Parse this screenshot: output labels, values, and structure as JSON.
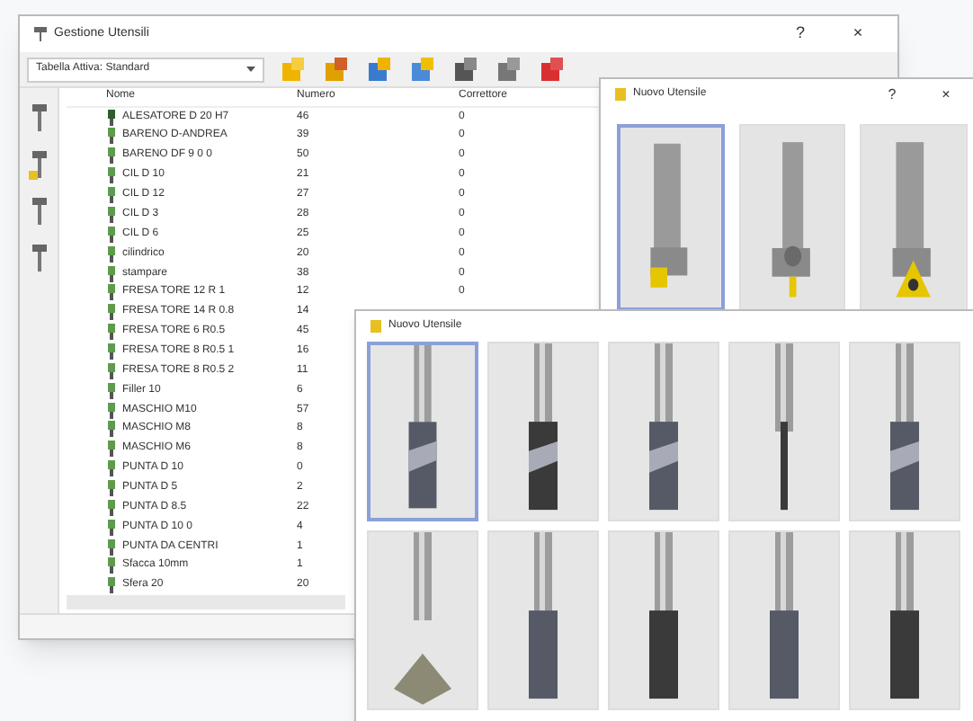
{
  "main_window": {
    "title": "Gestione Utensili",
    "controls": [
      "?",
      "×"
    ],
    "table_selector": {
      "value": "Tabella Attiva: Standard"
    },
    "table": {
      "columns": [
        "Nome",
        "Numero",
        "Correttore"
      ],
      "rows": [
        {
          "name": "ALESATORE D 20 H7",
          "number": "46",
          "corrector": "0"
        },
        {
          "name": "BARENO D-ANDREA",
          "number": "39",
          "corrector": "0"
        },
        {
          "name": "BARENO DF 9 0 0",
          "number": "50",
          "corrector": "0"
        },
        {
          "name": "CIL D 10",
          "number": "21",
          "corrector": "0"
        },
        {
          "name": "CIL D 12",
          "number": "27",
          "corrector": "0"
        },
        {
          "name": "CIL D 3",
          "number": "28",
          "corrector": "0"
        },
        {
          "name": "CIL D 6",
          "number": "25",
          "corrector": "0"
        },
        {
          "name": "cilindrico",
          "number": "20",
          "corrector": "0"
        },
        {
          "name": "stampare",
          "number": "38",
          "corrector": "0"
        },
        {
          "name": "FRESA TORE 12 R 1",
          "number": "12",
          "corrector": "0"
        },
        {
          "name": "FRESA TORE 14 R 0.8",
          "number": "14"
        },
        {
          "name": "FRESA TORE 6 R0.5",
          "number": "45"
        },
        {
          "name": "FRESA TORE 8 R0.5 1",
          "number": "16"
        },
        {
          "name": "FRESA TORE 8 R0.5 2",
          "number": "11"
        },
        {
          "name": "Filler 10",
          "number": "6"
        },
        {
          "name": "MASCHIO M10",
          "number": "57"
        },
        {
          "name": "MASCHIO M8",
          "number": "8"
        },
        {
          "name": "MASCHIO M6",
          "number": "8"
        },
        {
          "name": "PUNTA D 10",
          "number": "0"
        },
        {
          "name": "PUNTA D 5",
          "number": "2"
        },
        {
          "name": "PUNTA D 8.5",
          "number": "22"
        },
        {
          "name": "PUNTA D 10 0",
          "number": "4"
        },
        {
          "name": "PUNTA DA CENTRI",
          "number": "1"
        },
        {
          "name": "Sfacca 10mm",
          "number": "1"
        },
        {
          "name": "Sfera 20",
          "number": "20"
        }
      ]
    }
  },
  "dialogs": [
    {
      "title": "Nuovo Utensile",
      "controls": [
        "?",
        "×"
      ],
      "tiles": [
        {
          "selected": true
        },
        {
          "selected": false
        },
        {
          "selected": false
        }
      ]
    },
    {
      "title": "Nuovo Utensile",
      "tiles": [
        {
          "selected": true
        },
        {
          "selected": false
        },
        {
          "selected": false
        },
        {
          "selected": false
        },
        {
          "selected": false
        },
        {
          "selected": false
        },
        {
          "selected": false
        },
        {
          "selected": false
        },
        {
          "selected": false
        },
        {
          "selected": false
        }
      ]
    }
  ]
}
